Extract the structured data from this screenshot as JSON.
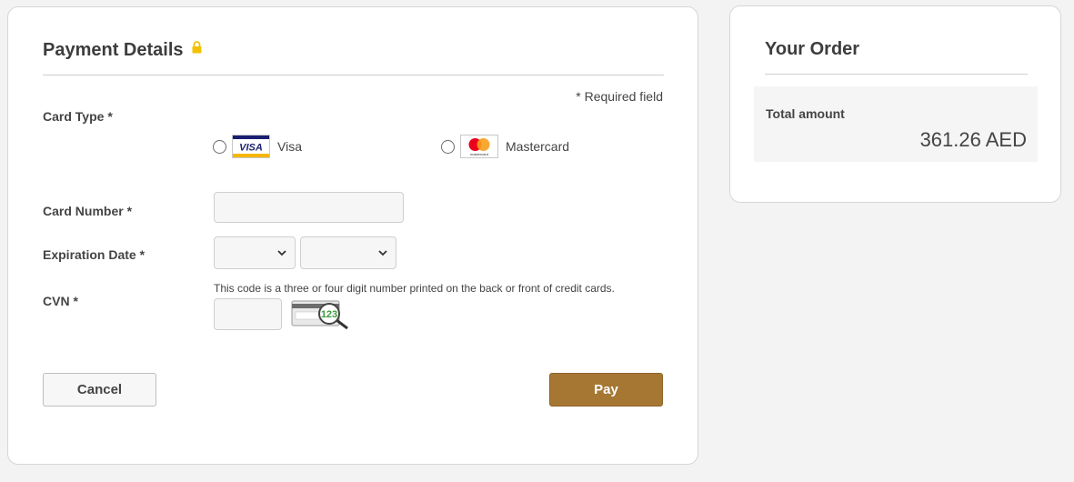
{
  "payment": {
    "title": "Payment Details",
    "required_note": "* Required field",
    "card_type_label": "Card Type *",
    "card_options": [
      {
        "label": "Visa",
        "logo_text": "VISA"
      },
      {
        "label": "Mastercard",
        "logo_text": "mastercard"
      }
    ],
    "card_number_label": "Card Number *",
    "card_number_value": "",
    "expiration_label": "Expiration Date *",
    "expiration_month_value": "",
    "expiration_year_value": "",
    "cvn_label": "CVN *",
    "cvn_hint": "This code is a three or four digit number printed on the back or front of credit cards.",
    "cvn_value": "",
    "cvn_image_text": "123",
    "cancel_label": "Cancel",
    "pay_label": "Pay"
  },
  "order": {
    "title": "Your Order",
    "total_label": "Total amount",
    "total_value": "361.26 AED"
  },
  "colors": {
    "pay_button": "#a67733",
    "lock_icon": "#f2c200",
    "mastercard_red": "#eb001b",
    "mastercard_orange": "#f79e1b",
    "visa_blue": "#1a1f71",
    "visa_gold": "#f7b600"
  }
}
